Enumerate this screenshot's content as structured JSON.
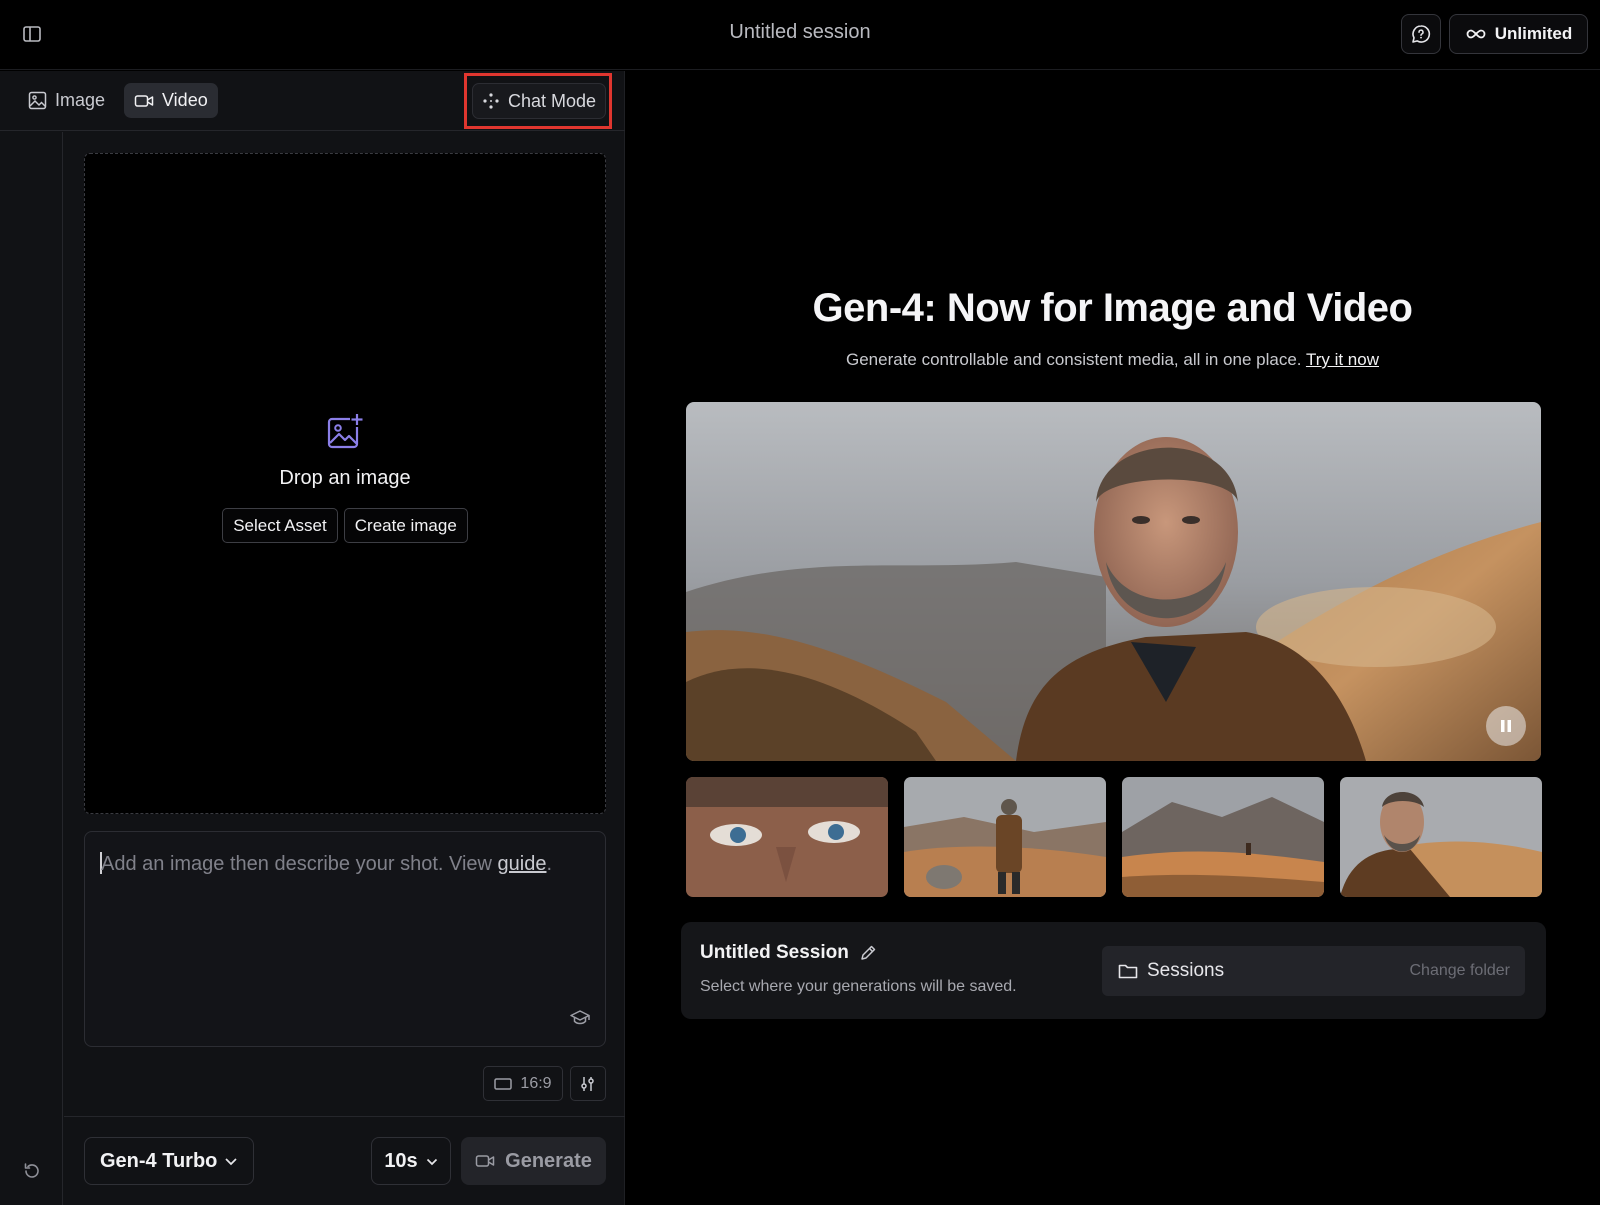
{
  "header": {
    "session_title": "Untitled session",
    "unlimited_label": "Unlimited"
  },
  "mode_tabs": [
    {
      "label": "Image",
      "icon": "image-icon",
      "active": false
    },
    {
      "label": "Video",
      "icon": "video-camera-icon",
      "active": true
    }
  ],
  "chat_mode": {
    "label": "Chat Mode",
    "icon": "sparkle-dots-icon",
    "highlighted": true,
    "highlight_color": "#e0362f"
  },
  "dropzone": {
    "title": "Drop an image",
    "select_asset": "Select Asset",
    "create_image": "Create image",
    "icon": "image-plus-icon",
    "icon_color": "#8b7fe8"
  },
  "prompt": {
    "placeholder_prefix": "Add an image then describe your shot. View ",
    "guide_link": "guide",
    "placeholder_suffix": "."
  },
  "controls": {
    "aspect_ratio": "16:9",
    "model": "Gen-4 Turbo",
    "duration": "10s",
    "generate_label": "Generate"
  },
  "promo": {
    "heading": "Gen-4: Now for Image and Video",
    "subtitle": "Generate controllable and consistent media, all in one place.",
    "try_link": "Try it now"
  },
  "session_card": {
    "title": "Untitled Session",
    "subtitle": "Select where your generations will be saved.",
    "folder": "Sessions",
    "change_folder": "Change folder"
  },
  "colors": {
    "accent_purple": "#8b7fe8",
    "highlight_red": "#e0362f",
    "panel_bg": "#111215",
    "page_bg": "#000000"
  }
}
